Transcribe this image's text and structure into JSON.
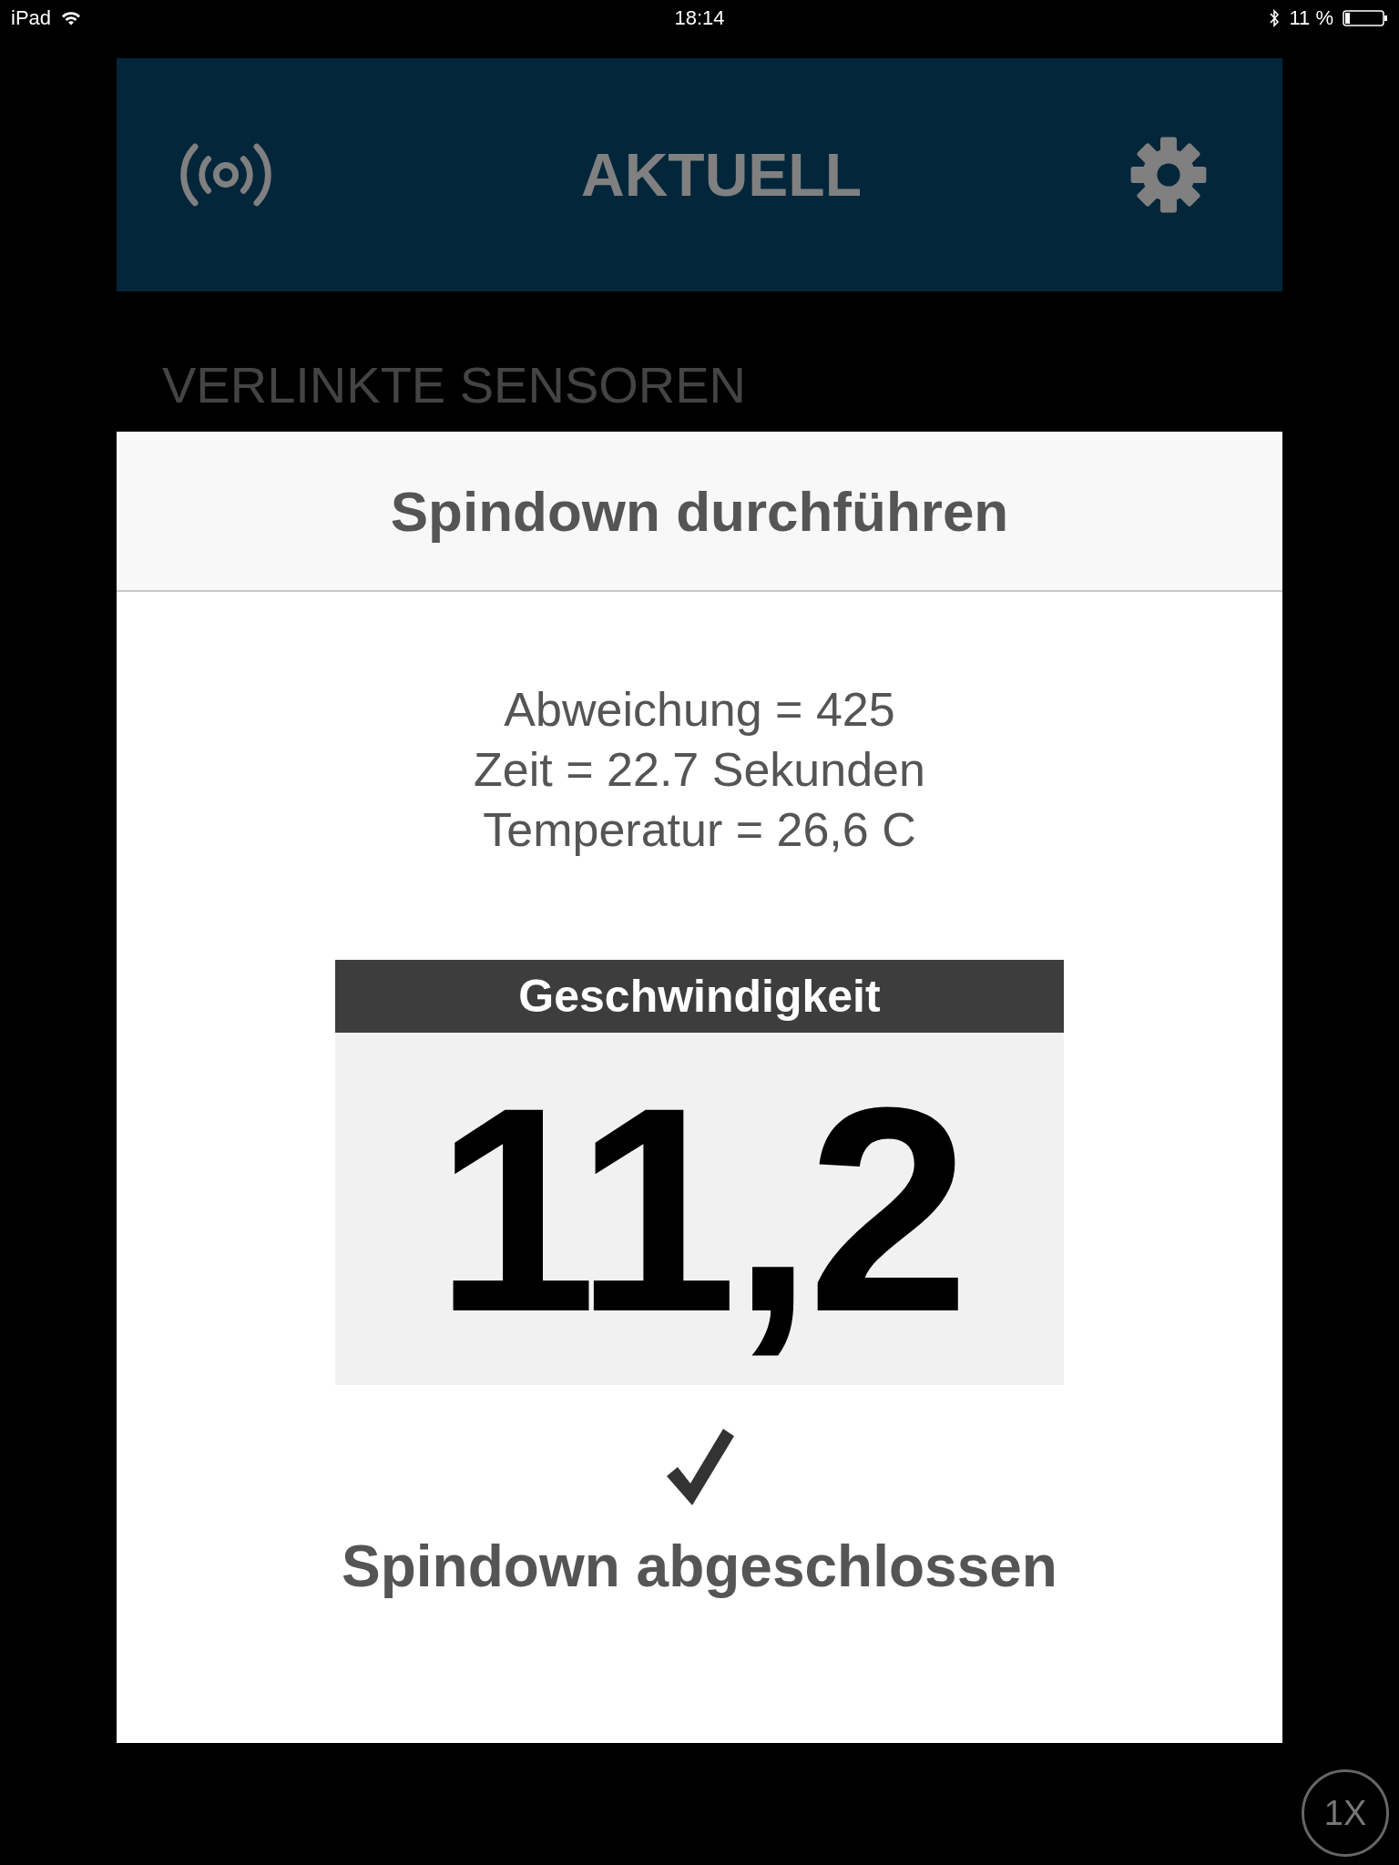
{
  "status_bar": {
    "device": "iPad",
    "time": "18:14",
    "battery": "11 %"
  },
  "header": {
    "title": "AKTUELL"
  },
  "section_label": "VERLINKTE SENSOREN",
  "dialog": {
    "title": "Spindown durchführen",
    "info_lines": [
      "Abweichung = 425",
      "Zeit = 22.7 Sekunden",
      "Temperatur = 26,6 C"
    ],
    "speed": {
      "label": "Geschwindigkeit",
      "value": "11,2"
    },
    "status_text": "Spindown abgeschlossen"
  },
  "zoom_button": {
    "label": "1X"
  }
}
